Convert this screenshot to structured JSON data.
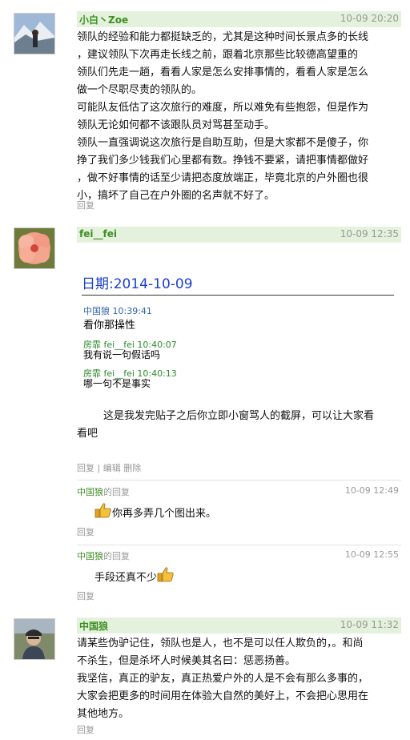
{
  "posts": [
    {
      "user": "小白丶Zoe",
      "time": "10-09 20:20",
      "lines": [
        "领队的经验和能力都挺缺乏的，尤其是这种时间长景点多的长线",
        "，建议领队下次再走长线之前，跟着北京那些比较德高望重的",
        "领队们先走一趟，看看人家是怎么安排事情的，看看人家是怎么",
        "做一个尽职尽责的领队的。",
        "可能队友低估了这次旅行的难度，所以难免有些抱怨，但是作为",
        "领队无论如何都不该跟队员对骂甚至动手。",
        "领队一直强调说这次旅行是自助互助，但是大家都不是傻子，你",
        "挣了我们多少钱我们心里都有数。挣钱不要紧，请把事情都做好",
        "，做不好事情的话至少请把态度放端正，毕竟北京的户外圈也很",
        "小，搞坏了自己在户外圈的名声就不好了。"
      ],
      "reply": "回复"
    },
    {
      "user": "fei__fei",
      "time": "10-09 12:35",
      "chat": {
        "date_label": "日期:2014-10-09",
        "messages": [
          {
            "sender": "中国狼  10:39:41",
            "text": "看你那操性"
          },
          {
            "sender": "房霏 fei__fei  10:40:07",
            "text": "我有说一句假话吗"
          },
          {
            "sender": "房霏 fei__fei  10:40:13",
            "text": "哪一句不是事实"
          }
        ]
      },
      "lines": [
        "        这是我发完贴子之后你立即小窗骂人的截屏，可以让大家看",
        "看吧"
      ],
      "reply": "回复",
      "edit": "编辑",
      "delete": "删除",
      "subreplies": [
        {
          "who": "中国狼",
          "of": "的回复",
          "time": "10-09 12:49",
          "text": "你再多弄几个图出来。",
          "reply": "回复"
        },
        {
          "who": "中国狼",
          "of": "的回复",
          "time": "10-09 12:55",
          "text": "手段还真不少",
          "reply": "回复"
        }
      ]
    },
    {
      "user": "中国狼",
      "time": "10-09 11:32",
      "lines": [
        "请某些伪驴记住，领队也是人，也不是可以任人欺负的，。和尚",
        "不杀生，但是杀坏人时候美其名曰：惩恶扬善。",
        "我坚信，真正的驴友，真正热爱户外的人是不会有那么多事的，",
        "大家会把更多的时间用在体验大自然的美好上，不会把心思用在",
        "其他地方。"
      ],
      "reply": "回复"
    }
  ]
}
